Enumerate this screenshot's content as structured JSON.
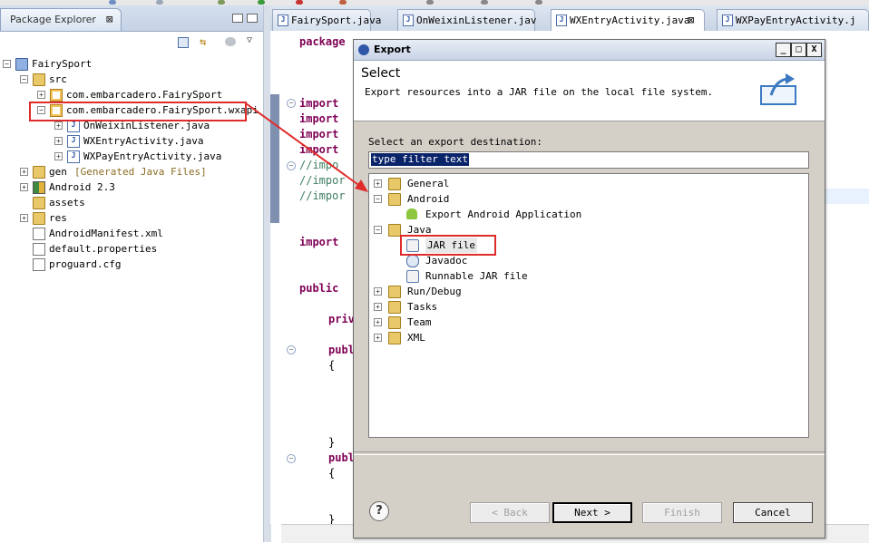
{
  "package_explorer": {
    "tab_label": "Package Explorer",
    "tree": [
      {
        "label": "FairySport",
        "level": 0,
        "icon": "project-icon",
        "expander": "minus"
      },
      {
        "label": "src",
        "level": 1,
        "icon": "source-folder-icon",
        "expander": "minus"
      },
      {
        "label": "com.embarcadero.FairySport",
        "level": 2,
        "icon": "package-icon",
        "expander": "plus"
      },
      {
        "label": "com.embarcadero.FairySport.wxapi",
        "level": 2,
        "icon": "package-icon",
        "expander": "minus",
        "highlighted": true
      },
      {
        "label": "OnWeixinListener.java",
        "level": 3,
        "icon": "java-file-icon",
        "expander": "plus"
      },
      {
        "label": "WXEntryActivity.java",
        "level": 3,
        "icon": "java-file-icon",
        "expander": "plus"
      },
      {
        "label": "WXPayEntryActivity.java",
        "level": 3,
        "icon": "java-file-icon",
        "expander": "plus"
      },
      {
        "label": "gen",
        "suffix": "[Generated Java Files]",
        "level": 1,
        "icon": "source-folder-icon",
        "expander": "plus"
      },
      {
        "label": "Android 2.3",
        "level": 1,
        "icon": "library-icon",
        "expander": "plus"
      },
      {
        "label": "assets",
        "level": 1,
        "icon": "folder-icon",
        "expander": "none"
      },
      {
        "label": "res",
        "level": 1,
        "icon": "folder-icon",
        "expander": "plus"
      },
      {
        "label": "AndroidManifest.xml",
        "level": 1,
        "icon": "xml-file-icon",
        "expander": "none"
      },
      {
        "label": "default.properties",
        "level": 1,
        "icon": "file-icon",
        "expander": "none"
      },
      {
        "label": "proguard.cfg",
        "level": 1,
        "icon": "file-icon",
        "expander": "none"
      }
    ]
  },
  "editor": {
    "tabs": [
      {
        "label": "FairySport.java",
        "active": false
      },
      {
        "label": "OnWeixinListener.jav",
        "active": false
      },
      {
        "label": "WXEntryActivity.java",
        "active": true
      },
      {
        "label": "WXPayEntryActivity.j",
        "active": false
      }
    ],
    "code_fragments": {
      "package": "package",
      "import1": "import",
      "import2": "import",
      "import3": "import",
      "import4": "import",
      "cm1": "//impo",
      "cm2": "//impor",
      "cm3": "//impor",
      "import5": "import",
      "public1": "public",
      "private1": "priv",
      "public2": "publ",
      "brace1": "{",
      "brace2": "}",
      "public3": "publ",
      "brace3": "{",
      "brace4": "}"
    }
  },
  "dialog": {
    "title": "Export",
    "header_title": "Select",
    "header_description": "Export resources into a JAR file on the local file system.",
    "destination_label": "Select an export destination:",
    "filter_value": "type filter text",
    "tree": [
      {
        "label": "General",
        "level": 0,
        "icon": "folder-icon",
        "expander": "plus"
      },
      {
        "label": "Android",
        "level": 0,
        "icon": "folder-icon",
        "expander": "minus"
      },
      {
        "label": "Export Android Application",
        "level": 1,
        "icon": "android-icon",
        "expander": "none"
      },
      {
        "label": "Java",
        "level": 0,
        "icon": "folder-icon",
        "expander": "minus"
      },
      {
        "label": "JAR file",
        "level": 1,
        "icon": "jar-icon",
        "expander": "none",
        "selected": true
      },
      {
        "label": "Javadoc",
        "level": 1,
        "icon": "javadoc-icon",
        "expander": "none"
      },
      {
        "label": "Runnable JAR file",
        "level": 1,
        "icon": "jar-icon",
        "expander": "none"
      },
      {
        "label": "Run/Debug",
        "level": 0,
        "icon": "folder-icon",
        "expander": "plus"
      },
      {
        "label": "Tasks",
        "level": 0,
        "icon": "folder-icon",
        "expander": "plus"
      },
      {
        "label": "Team",
        "level": 0,
        "icon": "folder-icon",
        "expander": "plus"
      },
      {
        "label": "XML",
        "level": 0,
        "icon": "folder-icon",
        "expander": "plus"
      }
    ],
    "buttons": {
      "back": "< Back",
      "next": "Next >",
      "finish": "Finish",
      "cancel": "Cancel"
    },
    "help_glyph": "?",
    "title_buttons": {
      "minimize": "_",
      "maximize": "□",
      "close": "X"
    }
  },
  "colors": {
    "annotation_red": "#e02b2b",
    "selection_blue": "#0a246a",
    "keyword": "#7f0055",
    "comment": "#3f7f5f"
  }
}
